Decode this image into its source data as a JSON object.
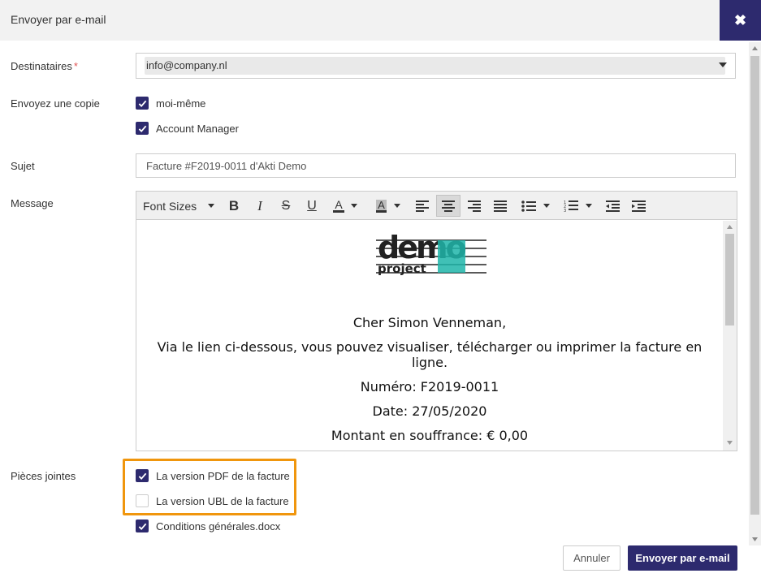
{
  "header": {
    "title": "Envoyer par e-mail",
    "close_icon": "close-icon"
  },
  "recipients": {
    "label": "Destinataires",
    "required_mark": "*",
    "value": "info@company.nl"
  },
  "copy": {
    "label": "Envoyez une copie",
    "options": [
      {
        "label": "moi-même",
        "checked": true
      },
      {
        "label": "Account Manager",
        "checked": true
      }
    ]
  },
  "subject": {
    "label": "Sujet",
    "value": "Facture #F2019-0011 d'Akti Demo"
  },
  "message": {
    "label": "Message",
    "toolbar": {
      "font_sizes_label": "Font Sizes"
    },
    "body": {
      "logo_text_top": "demo",
      "logo_text_bottom": "project",
      "greeting": "Cher Simon Venneman,",
      "intro": "Via le lien ci-dessous, vous pouvez visualiser, télécharger ou imprimer la facture en ligne.",
      "number": "Numéro: F2019-0011",
      "date": "Date: 27/05/2020",
      "amount": "Montant en souffrance: € 0,00"
    }
  },
  "attachments": {
    "label": "Pièces jointes",
    "items": [
      {
        "label": "La version PDF de la facture",
        "checked": true
      },
      {
        "label": "La version UBL de la facture",
        "checked": false
      },
      {
        "label": "Conditions générales.docx",
        "checked": true
      }
    ]
  },
  "buttons": {
    "cancel": "Annuler",
    "send": "Envoyer par e-mail"
  },
  "colors": {
    "primary": "#2d2a6e",
    "highlight": "#f0960d",
    "logo_teal": "#1fb5a9"
  }
}
